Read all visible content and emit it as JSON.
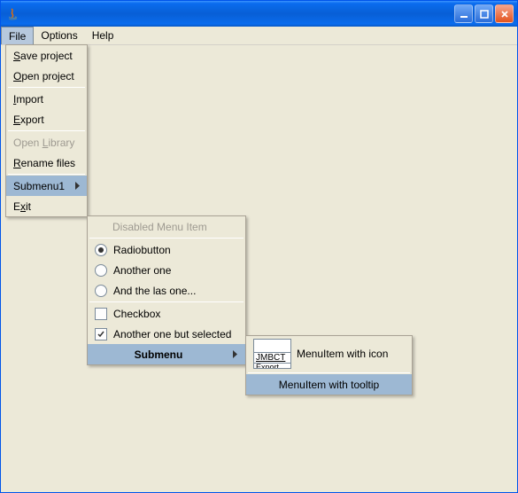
{
  "window": {
    "title": ""
  },
  "menubar": {
    "file": "File",
    "options": "Options",
    "help": "Help"
  },
  "fileMenu": {
    "save": "Save project",
    "open": "Open project",
    "import": "Import",
    "export": "Export",
    "openLibrary": "Open Library",
    "renameFiles": "Rename files",
    "submenu1": "Submenu1",
    "exit": "Exit"
  },
  "sub1": {
    "disabled": "Disabled Menu Item",
    "radio1": "Radiobutton",
    "radio2": "Another one",
    "radio3": "And the las one...",
    "check1": "Checkbox",
    "check2": "Another one but selected",
    "submenu": "Submenu"
  },
  "sub2": {
    "iconText": "JMBCT",
    "iconSub": "Export",
    "withIcon": "MenuItem with icon",
    "withTooltip": "MenuItem with tooltip"
  }
}
